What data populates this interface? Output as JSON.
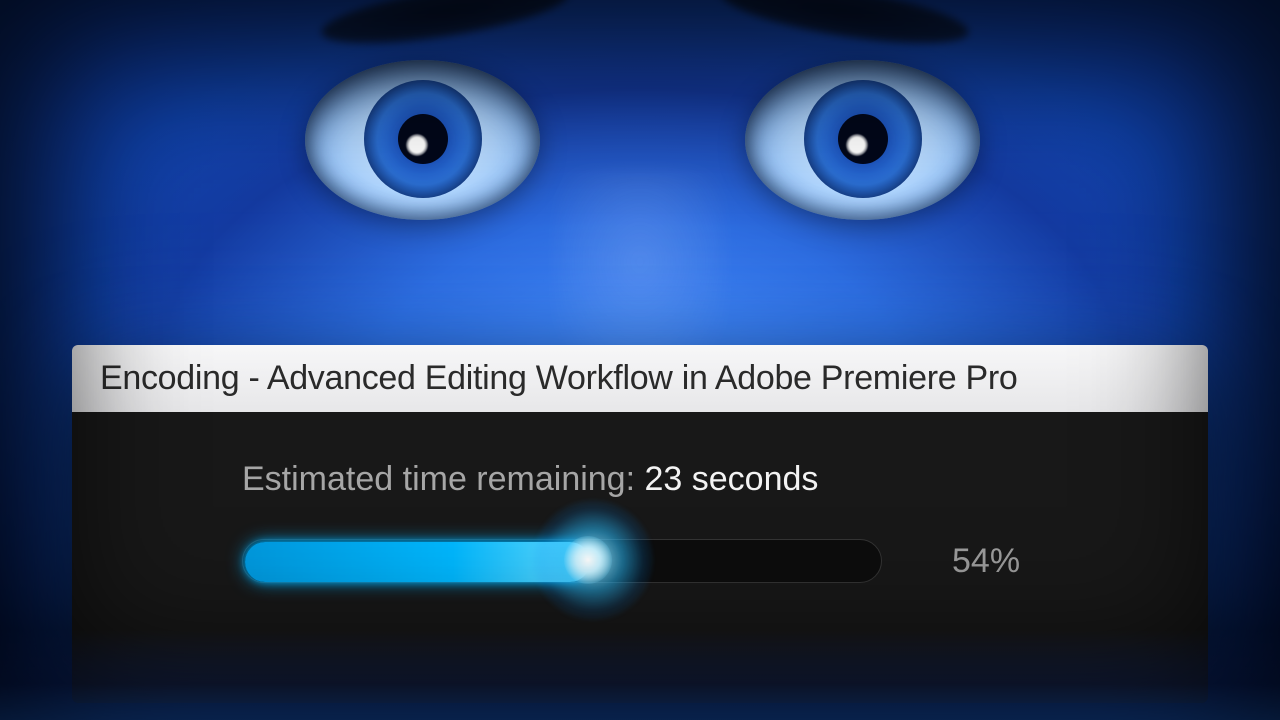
{
  "dialog": {
    "title": "Encoding - Advanced Editing Workflow in Adobe Premiere Pro",
    "eta_label": "Estimated time remaining: ",
    "eta_value": "23 seconds",
    "progress_percent": 54,
    "percent_text": "54%"
  },
  "colors": {
    "accent": "#00b8ff"
  }
}
